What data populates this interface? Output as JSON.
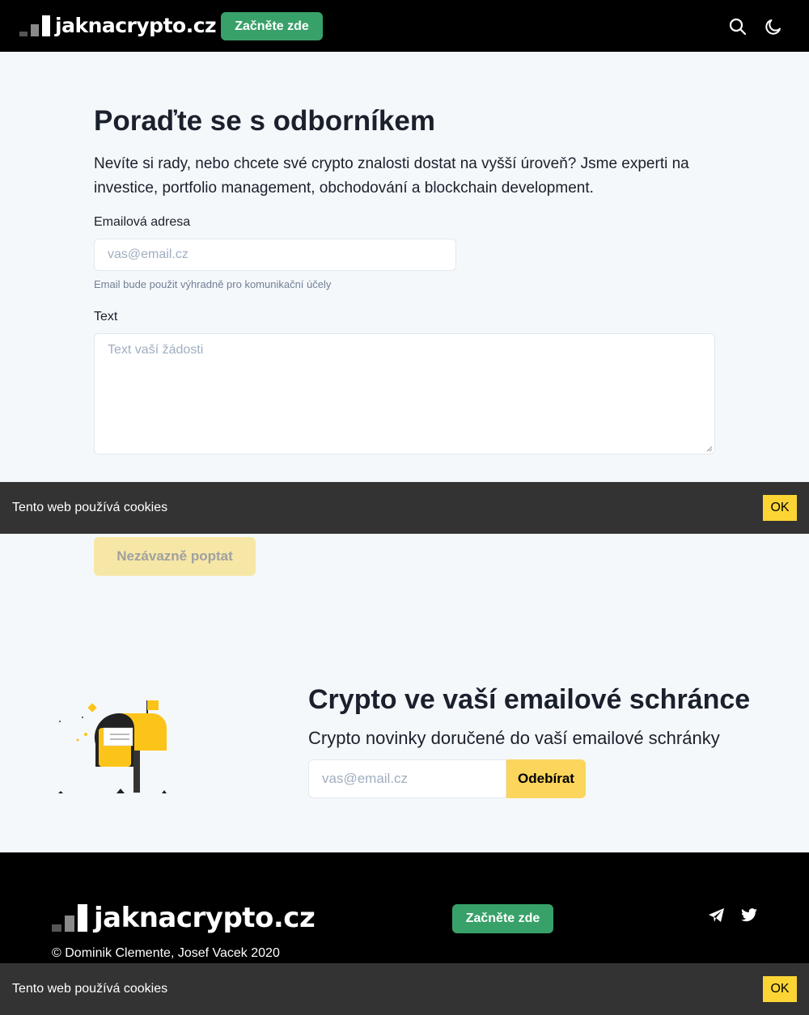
{
  "header": {
    "logo_text": "jaknacrypto.cz",
    "cta_label": "Začněte zde",
    "search_icon": "search-icon",
    "theme_icon": "moon-icon"
  },
  "consult": {
    "title": "Poraďte se s odborníkem",
    "lead": "Nevíte si rady, nebo chcete své crypto znalosti dostat na vyšší úroveň? Jsme experti na investice, portfolio management, obchodování a blockchain development.",
    "email_label": "Emailová adresa",
    "email_placeholder": "vas@email.cz",
    "email_help": "Email bude použit výhradně pro komunikační účely",
    "text_label": "Text",
    "text_placeholder": "Text vaší žádosti",
    "submit_label": "Nezávazně poptat"
  },
  "cookie_banner": {
    "message": "Tento web používá cookies",
    "ok_label": "OK"
  },
  "newsletter": {
    "title": "Crypto ve vaší emailové schránce",
    "subtitle": "Crypto novinky doručené do vaší emailové schránky",
    "email_placeholder": "vas@email.cz",
    "subscribe_label": "Odebírat"
  },
  "footer": {
    "logo_text": "jaknacrypto.cz",
    "cta_label": "Začněte zde",
    "copyright": "© Dominik Clemente, Josef Vacek 2020",
    "social_icons": [
      "telegram-icon",
      "twitter-icon"
    ]
  },
  "colors": {
    "accent_green": "#38a169",
    "accent_yellow": "#fcd535",
    "header_bg": "#000000",
    "page_bg": "#f5f8fb"
  }
}
